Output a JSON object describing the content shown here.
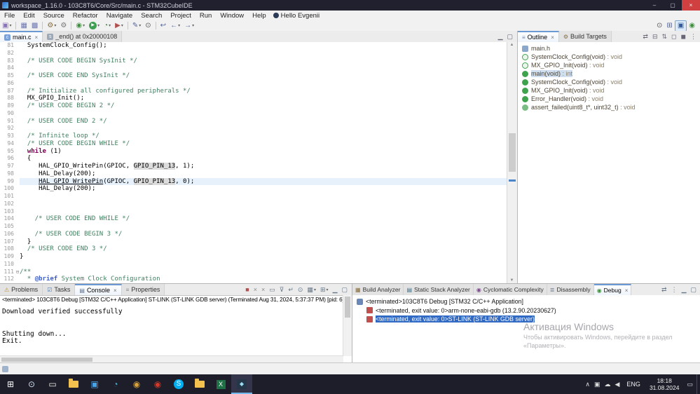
{
  "glyphs": {
    "close": "×",
    "dd": "▾",
    "up": "▲",
    "down": "▼"
  },
  "window": {
    "title": "workspace_1.16.0 - 103C8T6/Core/Src/main.c - STM32CubeIDE",
    "minimize": "–",
    "maximize": "▢",
    "close": "×"
  },
  "menubar": {
    "items": [
      "File",
      "Edit",
      "Source",
      "Refactor",
      "Navigate",
      "Search",
      "Project",
      "Run",
      "Window",
      "Help"
    ],
    "user_label": "Hello Evgenii"
  },
  "toolbar": {
    "icons": [
      {
        "name": "new-wizard-icon",
        "g": "▣",
        "c": "#8a72b8",
        "dd": true
      },
      {
        "sep": true
      },
      {
        "name": "save-icon",
        "g": "▦",
        "c": "#6a76b0"
      },
      {
        "name": "save-all-icon",
        "g": "▩",
        "c": "#6a76b0"
      },
      {
        "sep": true
      },
      {
        "name": "build-icon",
        "g": "⚙",
        "c": "#8a6d3b",
        "dd": true
      },
      {
        "name": "build-all-icon",
        "g": "⚙",
        "c": "#777777"
      },
      {
        "sep": true
      },
      {
        "name": "debug-icon",
        "g": "◉",
        "c": "#3f8f3f",
        "dd": true
      },
      {
        "name": "run-icon",
        "g": "▶",
        "c": "#ffffff",
        "cls": "run",
        "dd": true
      },
      {
        "name": "profile-icon",
        "g": "◔",
        "c": "#3f8f3f",
        "dd": true
      },
      {
        "name": "external-tools-icon",
        "g": "▶",
        "c": "#b05050",
        "dd": true
      },
      {
        "sep": true
      },
      {
        "name": "new-c-file-icon",
        "g": "✎",
        "c": "#556699",
        "dd": true
      },
      {
        "name": "search-icon",
        "g": "⊙",
        "c": "#555555"
      },
      {
        "sep": true
      },
      {
        "name": "last-edit-location-icon",
        "g": "↩",
        "c": "#556699"
      },
      {
        "name": "back-icon",
        "g": "←",
        "c": "#556699",
        "dd": true
      },
      {
        "name": "forward-icon",
        "g": "→",
        "c": "#556699",
        "dd": true
      }
    ],
    "right": [
      {
        "name": "quick-access-search-icon",
        "g": "⊙",
        "c": "#555555"
      },
      {
        "name": "open-perspective-icon",
        "g": "⊞",
        "c": "#556699"
      },
      {
        "name": "cpp-perspective-icon",
        "g": "▣",
        "c": "#335a9a",
        "cls": "persp-active"
      },
      {
        "name": "debug-perspective-icon",
        "g": "◉",
        "c": "#3f8f3f"
      }
    ]
  },
  "editor": {
    "tabs": [
      {
        "label": "main.c",
        "icon": {
          "name": "c-file-icon",
          "g": "c",
          "c": "#ffffff",
          "bg": "#7ba0d8"
        },
        "active": true,
        "closable": true
      },
      {
        "label": "_end() at 0x20000108",
        "icon": {
          "name": "asm-file-icon",
          "g": "s",
          "c": "#ffffff",
          "bg": "#9aa8b8"
        },
        "active": false,
        "closable": false
      }
    ],
    "tab_toolbar": [
      {
        "name": "minimize-view-icon",
        "g": "▁"
      },
      {
        "name": "maximize-view-icon",
        "g": "▢"
      }
    ],
    "lines": [
      {
        "num": 81,
        "segs": [
          {
            "t": "  SystemClock_Config();"
          }
        ]
      },
      {
        "num": 82,
        "segs": []
      },
      {
        "num": 83,
        "segs": [
          {
            "t": "  /* USER CODE BEGIN SysInit */",
            "c": "cm"
          }
        ]
      },
      {
        "num": 84,
        "segs": []
      },
      {
        "num": 85,
        "segs": [
          {
            "t": "  /* USER CODE END SysInit */",
            "c": "cm"
          }
        ]
      },
      {
        "num": 86,
        "segs": []
      },
      {
        "num": 87,
        "segs": [
          {
            "t": "  /* Initialize all configured peripherals */",
            "c": "cm"
          }
        ]
      },
      {
        "num": 88,
        "segs": [
          {
            "t": "  MX_GPIO_Init();"
          }
        ]
      },
      {
        "num": 89,
        "segs": [
          {
            "t": "  /* USER CODE BEGIN 2 */",
            "c": "cm"
          }
        ]
      },
      {
        "num": 90,
        "segs": []
      },
      {
        "num": 91,
        "segs": [
          {
            "t": "  /* USER CODE END 2 */",
            "c": "cm"
          }
        ]
      },
      {
        "num": 92,
        "segs": []
      },
      {
        "num": 93,
        "segs": [
          {
            "t": "  /* Infinite loop */",
            "c": "cm"
          }
        ]
      },
      {
        "num": 94,
        "segs": [
          {
            "t": "  /* USER CODE BEGIN WHILE */",
            "c": "cm"
          }
        ]
      },
      {
        "num": 95,
        "segs": [
          {
            "t": "  "
          },
          {
            "t": "while",
            "c": "kw"
          },
          {
            "t": " (1)"
          }
        ]
      },
      {
        "num": 96,
        "segs": [
          {
            "t": "  {"
          }
        ]
      },
      {
        "num": 97,
        "segs": [
          {
            "t": "     HAL_GPIO_WritePin(GPIOC, "
          },
          {
            "t": "GPIO_PIN_13",
            "c": "occ"
          },
          {
            "t": ", 1);"
          }
        ]
      },
      {
        "num": 98,
        "segs": [
          {
            "t": "     HAL_Delay(200);"
          }
        ]
      },
      {
        "num": 99,
        "cls": "current",
        "segs": [
          {
            "t": "     "
          },
          {
            "t": "HAL_GPIO_WritePin",
            "c": "link"
          },
          {
            "t": "(GPIOC, "
          },
          {
            "t": "GPIO_PIN_13",
            "c": "occ"
          },
          {
            "t": ", 0);"
          }
        ]
      },
      {
        "num": 100,
        "segs": [
          {
            "t": "     HAL_Delay(200);"
          }
        ]
      },
      {
        "num": 101,
        "segs": []
      },
      {
        "num": 102,
        "segs": []
      },
      {
        "num": 103,
        "segs": []
      },
      {
        "num": 104,
        "segs": [
          {
            "t": "    /* USER CODE END WHILE */",
            "c": "cm"
          }
        ]
      },
      {
        "num": 105,
        "segs": []
      },
      {
        "num": 106,
        "segs": [
          {
            "t": "    /* USER CODE BEGIN 3 */",
            "c": "cm"
          }
        ]
      },
      {
        "num": 107,
        "segs": [
          {
            "t": "  }"
          }
        ]
      },
      {
        "num": 108,
        "segs": [
          {
            "t": "  /* USER CODE END 3 */",
            "c": "cm"
          }
        ]
      },
      {
        "num": 109,
        "segs": [
          {
            "t": "}"
          }
        ]
      },
      {
        "num": 110,
        "segs": []
      },
      {
        "num": 111,
        "fold": true,
        "segs": [
          {
            "t": "/**",
            "c": "cm"
          }
        ]
      },
      {
        "num": 112,
        "segs": [
          {
            "t": "  * ",
            "c": "cm"
          },
          {
            "t": "@brief",
            "c": "doc"
          },
          {
            "t": " System Clock Configuration",
            "c": "cm"
          }
        ]
      }
    ]
  },
  "outline": {
    "tabs": [
      {
        "label": "Outline",
        "icon": {
          "name": "outline-view-icon",
          "g": "≡",
          "c": "#6a84a8"
        },
        "active": true,
        "closable": true
      },
      {
        "label": "Build Targets",
        "icon": {
          "name": "build-targets-icon",
          "g": "⚙",
          "c": "#8a6d3b"
        },
        "active": false
      }
    ],
    "toolbar": [
      {
        "name": "link-editor-icon",
        "g": "⇄"
      },
      {
        "name": "collapse-all-icon",
        "g": "⊟"
      },
      {
        "name": "sort-icon",
        "g": "⇅"
      },
      {
        "name": "hide-fields-icon",
        "g": "◻"
      },
      {
        "name": "hide-static-icon",
        "g": "◼"
      },
      {
        "name": "view-menu-icon",
        "g": "⋮"
      }
    ],
    "items": [
      {
        "icon": "include-icon",
        "name": "main.h",
        "type": ""
      },
      {
        "icon": "func-decl-icon",
        "name": "SystemClock_Config(void)",
        "type": " : void"
      },
      {
        "icon": "func-decl-icon",
        "name": "MX_GPIO_Init(void)",
        "type": " : void"
      },
      {
        "icon": "func-def-icon",
        "name": "main(void)",
        "type": " : int",
        "selected": true
      },
      {
        "icon": "func-def-icon",
        "name": "SystemClock_Config(void)",
        "type": " : void"
      },
      {
        "icon": "func-def-icon",
        "name": "MX_GPIO_Init(void)",
        "type": " : void"
      },
      {
        "icon": "func-def-icon",
        "name": "Error_Handler(void)",
        "type": " : void"
      },
      {
        "icon": "func-proto-icon",
        "name": "assert_failed(uint8_t*, uint32_t)",
        "type": " : void"
      }
    ]
  },
  "console": {
    "tabs": [
      {
        "label": "Problems",
        "icon": {
          "name": "problems-icon",
          "g": "⚠",
          "c": "#c89020"
        }
      },
      {
        "label": "Tasks",
        "icon": {
          "name": "tasks-icon",
          "g": "☑",
          "c": "#4a7ab5"
        }
      },
      {
        "label": "Console",
        "icon": {
          "name": "console-icon",
          "g": "▤",
          "c": "#5b6f8a"
        },
        "active": true,
        "closable": true
      },
      {
        "label": "Properties",
        "icon": {
          "name": "properties-icon",
          "g": "≡",
          "c": "#888888"
        }
      }
    ],
    "toolbar": [
      {
        "name": "terminate-icon",
        "g": "■",
        "c": "#b05050"
      },
      {
        "name": "remove-launch-icon",
        "g": "×",
        "c": "#888888"
      },
      {
        "name": "remove-all-launches-icon",
        "g": "×",
        "c": "#888888"
      },
      {
        "name": "clear-console-icon",
        "g": "▭",
        "c": "#667788"
      },
      {
        "name": "scroll-lock-icon",
        "g": "⊽",
        "c": "#667788"
      },
      {
        "name": "word-wrap-icon",
        "g": "↵",
        "c": "#667788"
      },
      {
        "name": "pin-console-icon",
        "g": "⊙",
        "c": "#667788"
      },
      {
        "name": "display-console-icon",
        "g": "▦",
        "c": "#667788",
        "dd": true
      },
      {
        "name": "open-console-icon",
        "g": "⊞",
        "c": "#667788",
        "dd": true
      },
      {
        "name": "minimize-view-icon",
        "g": "▁",
        "c": "#667788"
      },
      {
        "name": "maximize-view-icon",
        "g": "▢",
        "c": "#667788"
      }
    ],
    "header": "<terminated> 103C8T6 Debug [STM32 C/C++ Application] ST-LINK (ST-LINK GDB server) (Terminated Aug 31, 2024, 5:37:37 PM) [pid: 6]",
    "lines": [
      "Download verified successfully",
      "",
      "",
      "Shutting down...",
      "Exit."
    ]
  },
  "debugpanel": {
    "tabs": [
      {
        "label": "Build Analyzer",
        "icon": {
          "name": "build-analyzer-icon",
          "g": "▦",
          "c": "#8a6d3b"
        }
      },
      {
        "label": "Static Stack Analyzer",
        "icon": {
          "name": "stack-analyzer-icon",
          "g": "▤",
          "c": "#3b6e8a"
        }
      },
      {
        "label": "Cyclomatic Complexity",
        "icon": {
          "name": "cyclomatic-icon",
          "g": "◉",
          "c": "#7a4a8a"
        }
      },
      {
        "label": "Disassembly",
        "icon": {
          "name": "disassembly-icon",
          "g": "≣",
          "c": "#556677"
        }
      },
      {
        "label": "Debug",
        "icon": {
          "name": "debug-tab-icon",
          "g": "◉",
          "c": "#3f8f3f"
        },
        "active": true,
        "closable": true
      }
    ],
    "toolbar": [
      {
        "name": "link-debug-icon",
        "g": "⇄",
        "c": "#667788"
      },
      {
        "name": "view-menu-icon",
        "g": "⋮",
        "c": "#667788"
      },
      {
        "name": "minimize-view-icon",
        "g": "▁",
        "c": "#667788"
      },
      {
        "name": "maximize-view-icon",
        "g": "▢",
        "c": "#667788"
      }
    ],
    "tree": [
      {
        "indent": 0,
        "icon": "launch-icon",
        "text": "<terminated>103C8T6 Debug [STM32 C/C++ Application]"
      },
      {
        "indent": 1,
        "icon": "process-icon",
        "text": "<terminated, exit value: 0>arm-none-eabi-gdb (13.2.90.20230627)"
      },
      {
        "indent": 1,
        "icon": "process-icon",
        "text": "<terminated, exit value: 0>ST-LINK (ST-LINK GDB server)",
        "selected": true
      }
    ]
  },
  "watermark": {
    "title": "Активация Windows",
    "line1": "Чтобы активировать Windows, перейдите в раздел",
    "line2": "«Параметры»."
  },
  "taskbar": {
    "items": [
      {
        "name": "start-button",
        "g": "⊞",
        "c": "#ffffff"
      },
      {
        "name": "search-button",
        "g": "⊙",
        "c": "#cfe0f0"
      },
      {
        "name": "task-view-button",
        "g": "▭",
        "c": "#e8e8e8"
      },
      {
        "name": "file-explorer-button",
        "cls": "folder",
        "g": ""
      },
      {
        "name": "photos-button",
        "g": "▣",
        "c": "#4aa3e8"
      },
      {
        "name": "edge-button",
        "g": "◔",
        "c": "#3fb4d8"
      },
      {
        "name": "chrome-button",
        "g": "◉",
        "c": "#d8a23a"
      },
      {
        "name": "yandex-browser-button",
        "g": "◉",
        "c": "#d03a2a"
      },
      {
        "name": "skype-button",
        "cls": "skype",
        "g": "S"
      },
      {
        "name": "downloads-folder-button",
        "cls": "folder",
        "g": ""
      },
      {
        "name": "excel-button",
        "cls": "excel",
        "g": "X"
      },
      {
        "name": "stm32cubeide-button",
        "cls": "ide",
        "g": "◆",
        "active": true
      }
    ],
    "tray_icons": [
      {
        "name": "hidden-icons-chevron",
        "g": "∧"
      },
      {
        "name": "tray-stlink-icon",
        "g": "▣"
      },
      {
        "name": "tray-cloud-icon",
        "g": "☁"
      },
      {
        "name": "tray-volume-icon",
        "g": "◀"
      }
    ],
    "lang": "ENG",
    "time": "18:18",
    "date": "31.08.2024",
    "notification": {
      "name": "action-center-icon",
      "g": "▭"
    }
  }
}
